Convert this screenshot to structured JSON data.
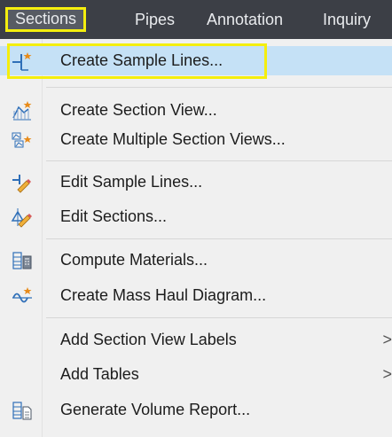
{
  "menubar": {
    "items": [
      {
        "label": "Sections",
        "active": true
      },
      {
        "label": "Pipes",
        "active": false
      },
      {
        "label": "Annotation",
        "active": false
      },
      {
        "label": "Inquiry",
        "active": false
      }
    ]
  },
  "menu": {
    "items": [
      {
        "label": "Create Sample Lines...",
        "icon": "create-sample-lines-icon",
        "highlighted": true
      },
      {
        "label": "Create Section View...",
        "icon": "create-section-view-icon"
      },
      {
        "label": "Create Multiple Section Views...",
        "icon": "create-multiple-section-views-icon"
      },
      {
        "label": "Edit Sample Lines...",
        "icon": "edit-sample-lines-icon"
      },
      {
        "label": "Edit Sections...",
        "icon": "edit-sections-icon"
      },
      {
        "label": "Compute Materials...",
        "icon": "compute-materials-icon"
      },
      {
        "label": "Create Mass Haul Diagram...",
        "icon": "mass-haul-diagram-icon"
      },
      {
        "label": "Add Section View Labels",
        "submenu": true,
        "arrow": ">"
      },
      {
        "label": "Add Tables",
        "submenu": true,
        "arrow": ">"
      },
      {
        "label": "Generate Volume Report...",
        "icon": "volume-report-icon"
      }
    ]
  },
  "colors": {
    "menubar_bg": "#3c3f46",
    "highlight_frame": "#f4ee0e",
    "hover_bg": "#c5e1f6",
    "icon_blue": "#2f6fb8",
    "icon_orange": "#e88b1a"
  }
}
